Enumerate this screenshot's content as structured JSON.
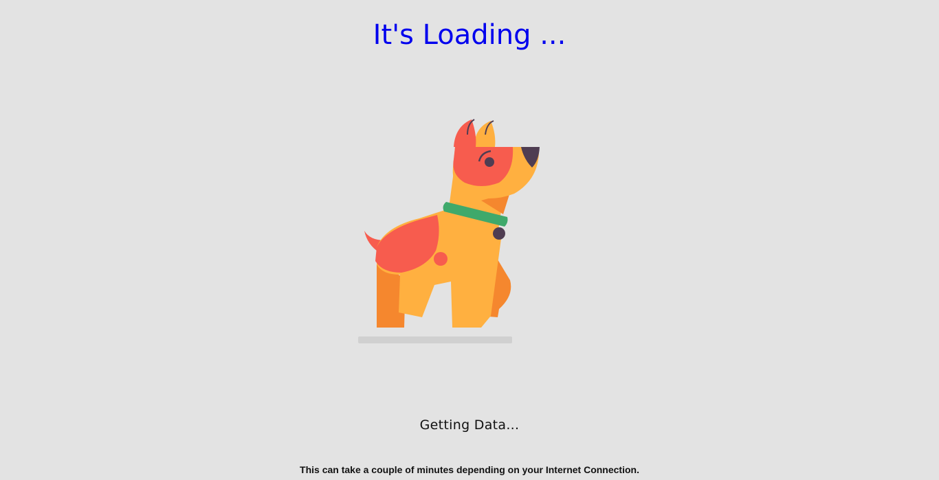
{
  "loader": {
    "title": "It's Loading ...",
    "status": "Getting Data...",
    "note": "This can take a couple of minutes depending on your Internet Connection.",
    "icon": "dog-illustration"
  },
  "colors": {
    "background": "#e3e3e3",
    "title": "#0000ee",
    "dog_body": "#ffb040",
    "dog_spots": "#f75c4e",
    "dog_shadow_legs": "#f5872e",
    "collar": "#3fa96b",
    "dark": "#4f3d52",
    "floor_shadow": "#d0d0d0"
  }
}
